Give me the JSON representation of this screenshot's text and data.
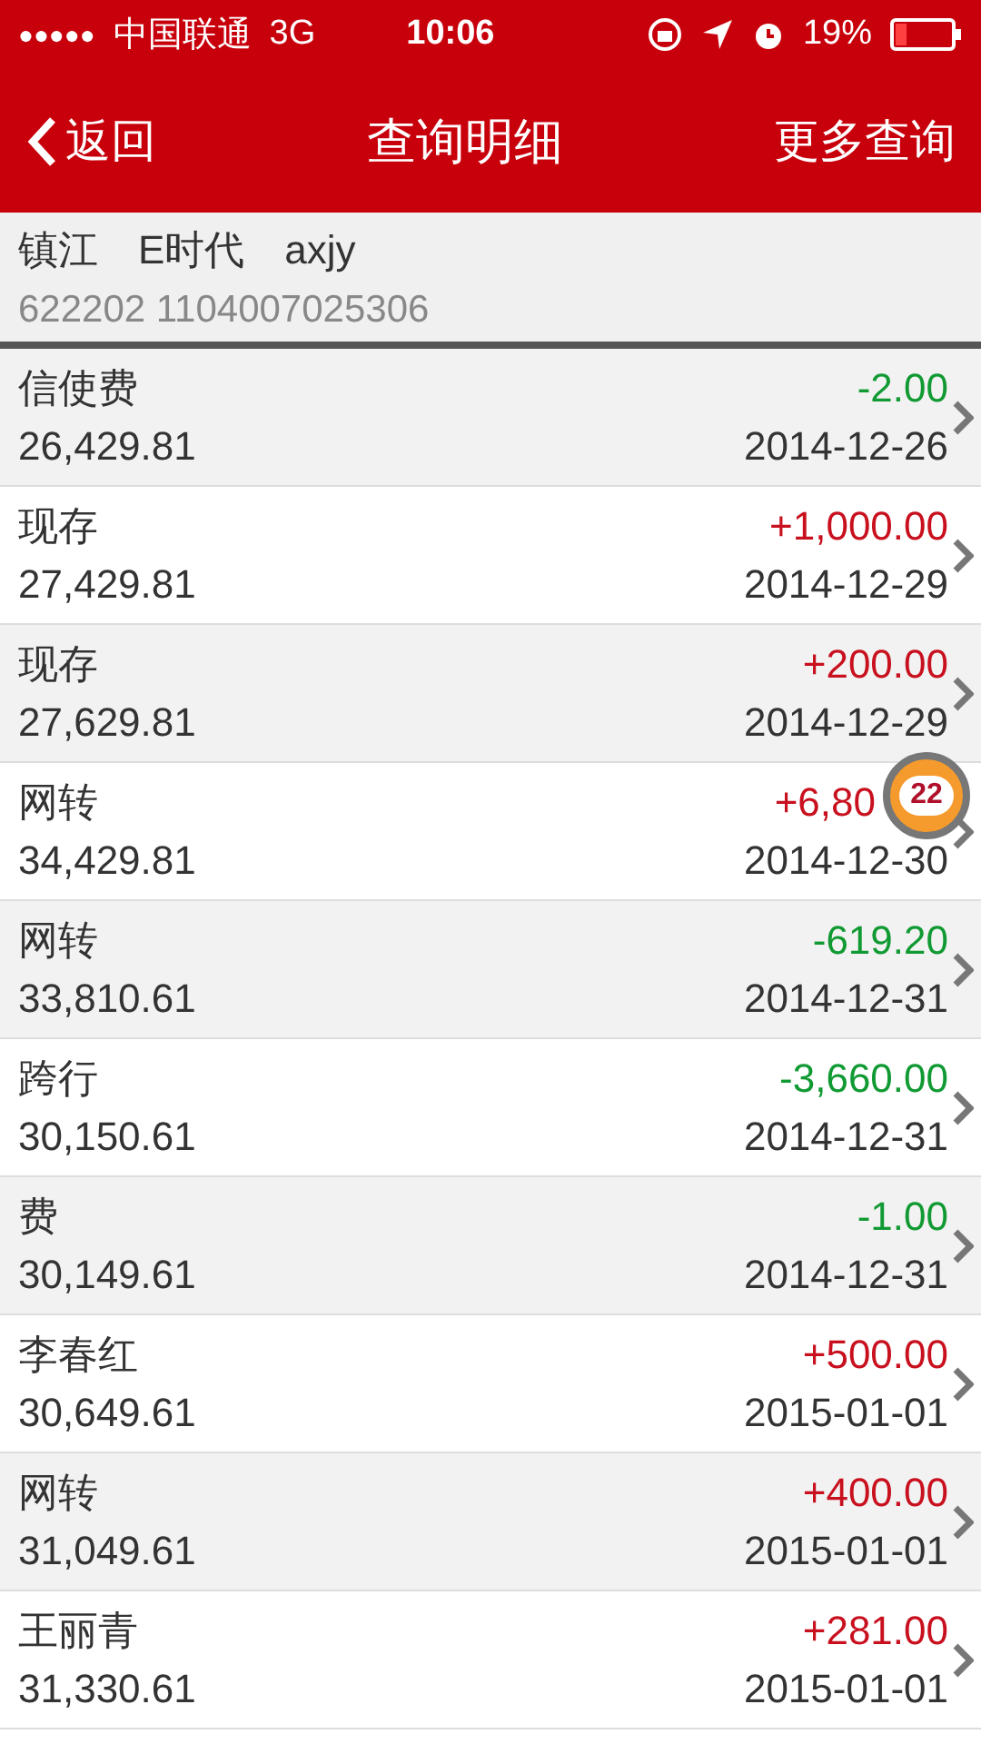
{
  "status_bar": {
    "signal": "●●●●●",
    "carrier": "中国联通",
    "network": "3G",
    "time": "10:06",
    "battery": "19%"
  },
  "nav": {
    "back": "返回",
    "title": "查询明细",
    "action": "更多查询"
  },
  "account": {
    "name": "镇江　E时代　axjy",
    "number": "622202 1104007025306"
  },
  "transactions": [
    {
      "desc": "信使费",
      "balance": "26,429.81",
      "amount": "-2.00",
      "kind": "out",
      "date": "2014-12-26"
    },
    {
      "desc": "现存",
      "balance": "27,429.81",
      "amount": "+1,000.00",
      "kind": "in",
      "date": "2014-12-29"
    },
    {
      "desc": "现存",
      "balance": "27,629.81",
      "amount": "+200.00",
      "kind": "in",
      "date": "2014-12-29"
    },
    {
      "desc": "网转",
      "balance": "34,429.81",
      "amount": "+6,80",
      "kind": "in",
      "cut_off": true,
      "date": "2014-12-30"
    },
    {
      "desc": "网转",
      "balance": "33,810.61",
      "amount": "-619.20",
      "kind": "out",
      "date": "2014-12-31"
    },
    {
      "desc": "跨行",
      "balance": "30,150.61",
      "amount": "-3,660.00",
      "kind": "out",
      "date": "2014-12-31"
    },
    {
      "desc": "费",
      "balance": "30,149.61",
      "amount": "-1.00",
      "kind": "out",
      "date": "2014-12-31"
    },
    {
      "desc": "李春红",
      "balance": "30,649.61",
      "amount": "+500.00",
      "kind": "in",
      "date": "2015-01-01"
    },
    {
      "desc": "网转",
      "balance": "31,049.61",
      "amount": "+400.00",
      "kind": "in",
      "date": "2015-01-01"
    },
    {
      "desc": "王丽青",
      "balance": "31,330.61",
      "amount": "+281.00",
      "kind": "in",
      "date": "2015-01-01"
    }
  ],
  "floating_badge": {
    "count": "22"
  }
}
